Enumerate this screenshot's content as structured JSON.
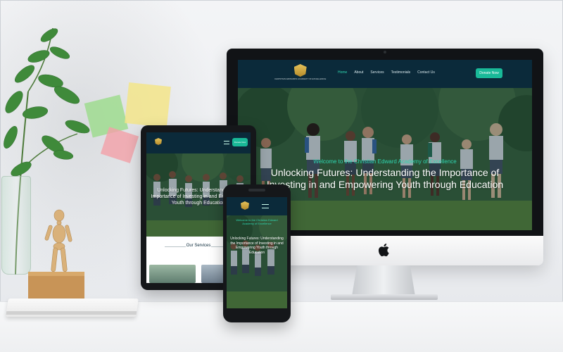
{
  "site": {
    "logo_text": "CHRISTIAN EDWARDS ACADEMY OF EXCELLENCE",
    "nav": [
      {
        "label": "Home"
      },
      {
        "label": "About"
      },
      {
        "label": "Services"
      },
      {
        "label": "Testimonials"
      },
      {
        "label": "Contact Us"
      }
    ],
    "donate_label": "Donate Now",
    "hero_welcome": "Welcome to the Christian Edward Academy of Excellence",
    "hero_title": "Unlocking Futures: Understanding the Importance of Investing in and Empowering Youth through Education",
    "services_heading": "Our Services"
  },
  "tablet": {
    "donate_label": "Donate Now"
  },
  "phone": {
    "hero_welcome": "Welcome to the Christian Edward Academy of Excellence"
  },
  "colors": {
    "header_bg": "#0b2a3a",
    "accent": "#19b998",
    "accent_text": "#2fd6b0"
  },
  "icons": {
    "menu": "menu-icon",
    "apple": "apple-logo-icon"
  }
}
